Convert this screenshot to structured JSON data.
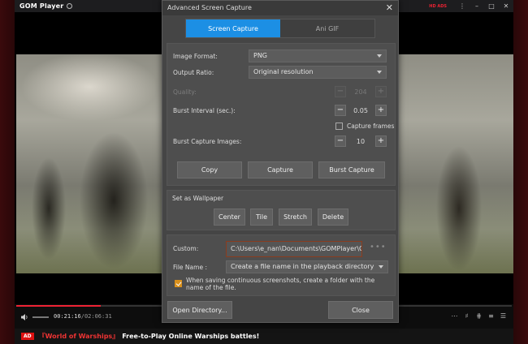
{
  "player": {
    "logo": "GOM Player",
    "hd_badge": "HD ADS",
    "window_controls": [
      "⋮",
      "–",
      "□",
      "✕"
    ],
    "current_time": "00:21:16",
    "total_time": "02:06:31",
    "progress": 0.17,
    "ad": {
      "badge": "AD",
      "game": "『World of Warships』",
      "text": "Free-to-Play Online Warships battles!"
    },
    "control_icons": [
      "settings-dots-icon",
      "equalizer-icon",
      "equalizer2-icon",
      "list-icon",
      "playlist-icon"
    ]
  },
  "dialog": {
    "title": "Advanced Screen Capture",
    "close_glyph": "✕",
    "tabs": [
      {
        "label": "Screen Capture",
        "active": true
      },
      {
        "label": "Ani GIF",
        "active": false
      }
    ],
    "image_format": {
      "label": "Image Format:",
      "value": "PNG"
    },
    "output_ratio": {
      "label": "Output Ratio:",
      "value": "Original resolution"
    },
    "quality": {
      "label": "Quality:",
      "value": "204"
    },
    "burst_interval": {
      "label": "Burst Interval (sec.):",
      "value": "0.05"
    },
    "capture_frames": {
      "label": "Capture frames",
      "checked": false
    },
    "burst_images": {
      "label": "Burst Capture Images:",
      "value": "10"
    },
    "buttons": {
      "copy": "Copy",
      "capture": "Capture",
      "burst": "Burst Capture"
    },
    "wallpaper": {
      "title": "Set as Wallpaper",
      "center": "Center",
      "tile": "Tile",
      "stretch": "Stretch",
      "delete": "Delete"
    },
    "custom": {
      "label": "Custom:",
      "path": "C:\\Users\\e_nan\\Documents\\GOMPlayer\\Captur",
      "more": "•••"
    },
    "file_name": {
      "label": "File Name :",
      "value": "Create a file name in the playback directory"
    },
    "folder_option": {
      "checked": true,
      "text": "When saving continuous screenshots, create a folder with the name of the file."
    },
    "open_directory": "Open Directory...",
    "close": "Close"
  }
}
